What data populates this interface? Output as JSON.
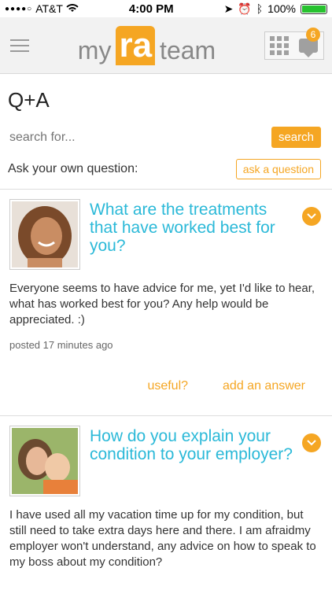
{
  "status_bar": {
    "carrier": "AT&T",
    "time": "4:00 PM",
    "battery": "100%",
    "battery_level": 1.0
  },
  "header": {
    "logo_my": "my",
    "logo_ra": "ra",
    "logo_team": "team",
    "notification_count": "6"
  },
  "page": {
    "title": "Q+A"
  },
  "search": {
    "placeholder": "search for...",
    "button_label": "search"
  },
  "ask": {
    "label": "Ask your own question:",
    "button_label": "ask a question"
  },
  "questions": [
    {
      "title": "What are the treatments that have worked best for you?",
      "body": "Everyone seems to have advice for me, yet I'd like to hear, what has worked best for you? Any help would be appreciated. :)",
      "posted": "posted 17 minutes ago",
      "useful_label": "useful?",
      "answer_label": "add an answer"
    },
    {
      "title": "How do you explain your condition to your employer?",
      "body": "I have used all my vacation time up for my condition, but still need to take extra days here and there.  I am afraidmy employer won't understand, any advice on how to speak to my boss about my condition?"
    }
  ],
  "colors": {
    "accent": "#f5a623",
    "title": "#2bb9d8"
  }
}
